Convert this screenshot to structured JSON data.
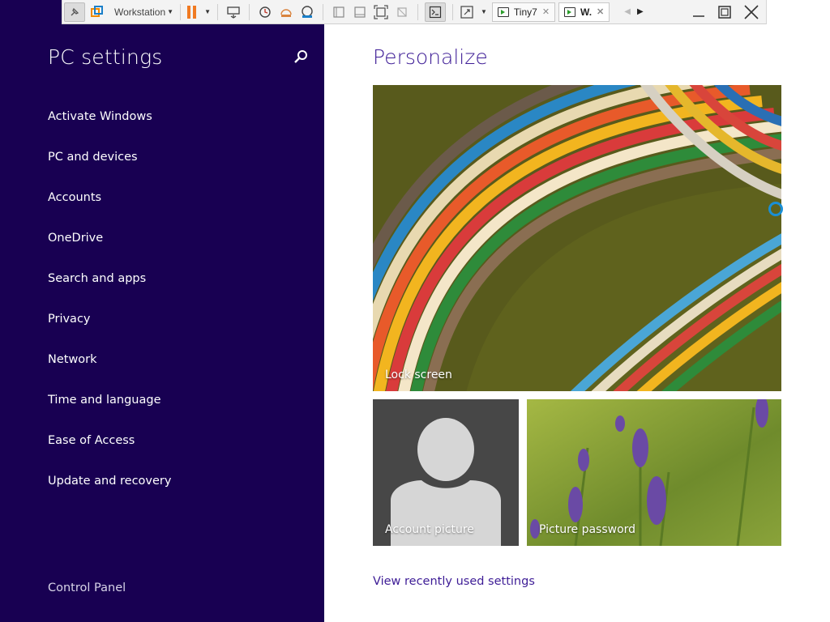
{
  "vm_toolbar": {
    "workstation_label": "Workstation",
    "tabs": [
      {
        "label": "Tiny7",
        "close": "✕"
      },
      {
        "label": "W.",
        "close": "✕"
      }
    ],
    "icons": [
      "pin-icon",
      "vmware-logo-icon",
      "pause-icon",
      "send-ctrl-alt-del-icon",
      "snapshot-icon",
      "revert-snapshot-icon",
      "snapshot-manager-icon",
      "console-view-icon",
      "thumbnail-view-icon",
      "fit-guest-icon",
      "autofit-icon",
      "terminal-icon",
      "fullscreen-icon"
    ]
  },
  "sidebar": {
    "title": "PC settings",
    "search_icon": "search-icon",
    "items": [
      {
        "label": "Activate Windows"
      },
      {
        "label": "PC and devices"
      },
      {
        "label": "Accounts"
      },
      {
        "label": "OneDrive"
      },
      {
        "label": "Search and apps"
      },
      {
        "label": "Privacy"
      },
      {
        "label": "Network"
      },
      {
        "label": "Time and language"
      },
      {
        "label": "Ease of Access"
      },
      {
        "label": "Update and recovery"
      }
    ],
    "footer_link": "Control Panel"
  },
  "main": {
    "title": "Personalize",
    "tiles": {
      "lock_screen": "Lock screen",
      "account_picture": "Account picture",
      "picture_password": "Picture password"
    },
    "link": "View recently used settings"
  },
  "colors": {
    "sidebar_bg": "#180052",
    "accent": "#3d1c96",
    "vm_pause": "#f07a22"
  }
}
